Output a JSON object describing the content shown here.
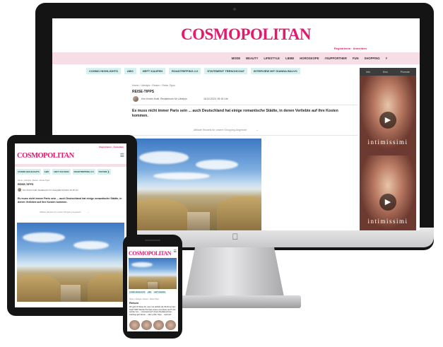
{
  "brand": {
    "logo_text": "COSMOPOLITAN",
    "accent_color": "#e4186c"
  },
  "header": {
    "login_text": "Registrieren · Anmelden"
  },
  "nav": {
    "items": [
      "MODE",
      "BEAUTY",
      "LIFESTYLE",
      "LIEBE",
      "HOROSKOPE",
      "#SUPPORTHER",
      "FUN",
      "SHOPPING",
      "#"
    ]
  },
  "tags": [
    "COSMO HIGHLIGHTS",
    "ABO",
    "HEFT KAUFEN",
    "ROADTRIPPING 2.0",
    "STATEMENT TRENCHCOAT",
    "INTERVIEW MIT GIANNA BALVO"
  ],
  "tablet_tags": [
    "COSMO HIGHLIGHTS",
    "ABO",
    "HEFT KAUFEN",
    "ROADTRIPPING 2.0",
    "STATEM ❯"
  ],
  "phone_tags": [
    "COSMO HIGHLIGHTS",
    "ABO",
    "HEFT KAUFEN"
  ],
  "article": {
    "breadcrumb": "Home › Lifestyle › Reisen › Reise-Tipps",
    "section": "REISE-TIPPS",
    "author": "Kim Kristin Kraft, Redakteurin für Lifestyle",
    "date": "18.04.2023, 09:15 Uhr",
    "intro": "Es muss nicht immer Paris sein ... auch Deutschland hat einige romantische Städte, in denen Verliebte auf ihre Kosten kommen.",
    "affiliate_note": "Affiliate Hinweis für unsere Shopping-Angebote",
    "affiliate_chevron": "⌄"
  },
  "phone": {
    "heading": "Reisen",
    "intro": "Wir geht Ihr Reise hin, wenn sie definitiv die Wucht auf den Kopf? WIR! Welche Hot-Spot unsere eine Reise wert? Und welche zum ... Untersetzung? Unsere Redakteurinnen-Lieblinge geht dieser ... alles schön Tipps ... sammelt!"
  },
  "ad": {
    "tabs": [
      "Info",
      "Kino",
      "Promote"
    ],
    "brand": "intimissimi",
    "play_icon": "▶"
  },
  "menu_icon": "☰",
  "apple_logo": ""
}
